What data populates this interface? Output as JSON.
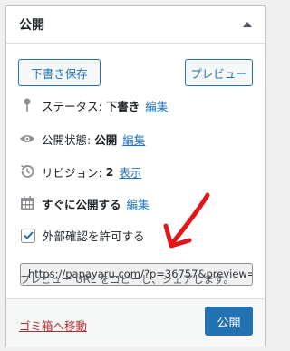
{
  "panel": {
    "title": "公開"
  },
  "buttons": {
    "save_draft": "下書き保存",
    "preview": "プレビュー",
    "publish": "公開"
  },
  "status": {
    "label": "ステータス:",
    "value": "下書き",
    "edit": "編集"
  },
  "visibility": {
    "label": "公開状態:",
    "value": "公開",
    "edit": "編集"
  },
  "revisions": {
    "label": "リビジョン:",
    "value": "2",
    "link": "表示"
  },
  "schedule": {
    "label": "すぐに公開する",
    "edit": "編集"
  },
  "external_preview": {
    "checkbox_label": "外部確認を許可する",
    "checked": true,
    "url": "https://papayaru.com/?p=36757&preview=",
    "hint": "プレビュー URL をコピーし、シェアします。"
  },
  "footer": {
    "trash": "ゴミ箱へ移動"
  },
  "colors": {
    "accent": "#2271b1",
    "danger": "#b32d2e",
    "annotation": "#e0161b"
  }
}
